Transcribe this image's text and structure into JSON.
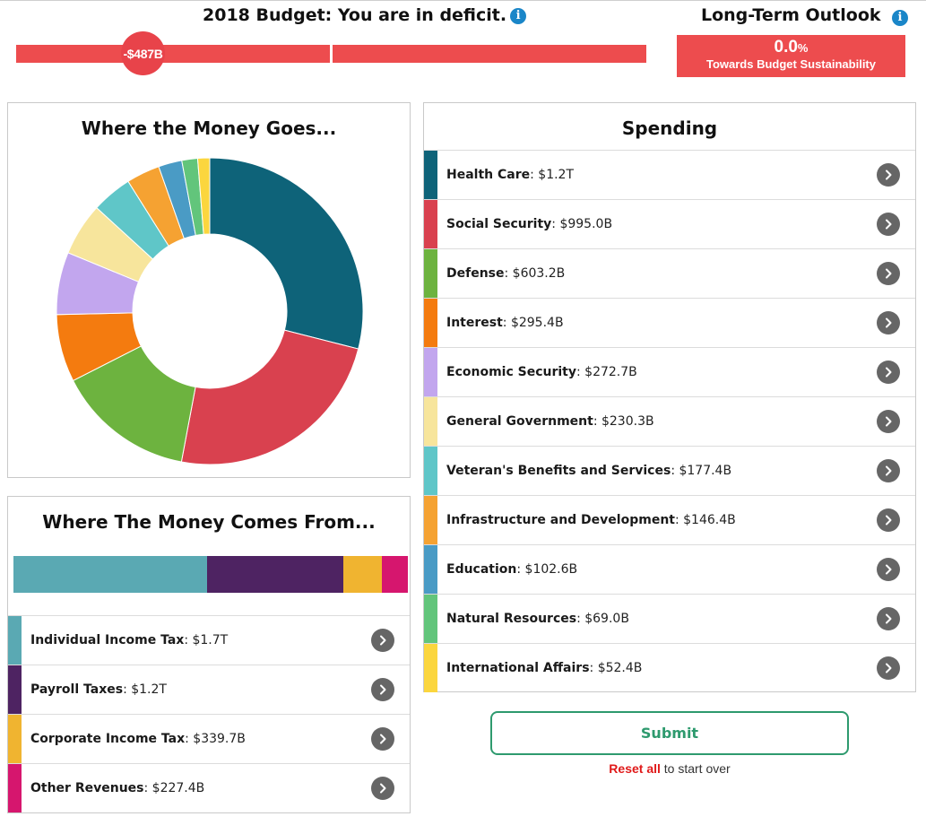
{
  "header": {
    "budget_title": "2018 Budget: You are in deficit.",
    "deficit_label": "-$487B",
    "outlook_title": "Long-Term Outlook",
    "outlook_value": "0.0",
    "outlook_unit": "%",
    "outlook_caption": "Towards Budget Sustainability",
    "accent_color": "#ed4c4e",
    "info_color": "#1a86c8"
  },
  "where_goes": {
    "title": "Where the Money Goes..."
  },
  "where_comes": {
    "title": "Where The Money Comes From...",
    "items": [
      {
        "name": "Individual Income Tax",
        "amount": ": $1.7T",
        "color": "#5aa9b3",
        "value": 1700
      },
      {
        "name": "Payroll Taxes",
        "amount": ": $1.2T",
        "color": "#4e2362",
        "value": 1200
      },
      {
        "name": "Corporate Income Tax",
        "amount": ": $339.7B",
        "color": "#f0b430",
        "value": 339.7
      },
      {
        "name": "Other Revenues",
        "amount": ": $227.4B",
        "color": "#d6166e",
        "value": 227.4
      }
    ]
  },
  "spending": {
    "title": "Spending",
    "items": [
      {
        "name": "Health Care",
        "amount": ": $1.2T",
        "color": "#0e6379",
        "value": 1200
      },
      {
        "name": "Social Security",
        "amount": ": $995.0B",
        "color": "#d9414f",
        "value": 995.0
      },
      {
        "name": "Defense",
        "amount": ": $603.2B",
        "color": "#6db33f",
        "value": 603.2
      },
      {
        "name": "Interest",
        "amount": ": $295.4B",
        "color": "#f47b0f",
        "value": 295.4
      },
      {
        "name": "Economic Security",
        "amount": ": $272.7B",
        "color": "#c2a6ee",
        "value": 272.7
      },
      {
        "name": "General Government",
        "amount": ": $230.3B",
        "color": "#f7e59c",
        "value": 230.3
      },
      {
        "name": "Veteran's Benefits and Services",
        "amount": ": $177.4B",
        "color": "#5fc6c8",
        "value": 177.4
      },
      {
        "name": "Infrastructure and Development",
        "amount": ": $146.4B",
        "color": "#f5a232",
        "value": 146.4
      },
      {
        "name": "Education",
        "amount": ": $102.6B",
        "color": "#4a9bc5",
        "value": 102.6
      },
      {
        "name": "Natural Resources",
        "amount": ": $69.0B",
        "color": "#62c57b",
        "value": 69.0
      },
      {
        "name": "International Affairs",
        "amount": ": $52.4B",
        "color": "#fbd63e",
        "value": 52.4
      }
    ]
  },
  "actions": {
    "submit_label": "Submit",
    "reset_link": "Reset all",
    "reset_suffix": " to start over"
  },
  "icons": {
    "info": "info-icon",
    "row_arrow": "chevron-right-icon",
    "cursor": "mouse-pointer-icon"
  }
}
